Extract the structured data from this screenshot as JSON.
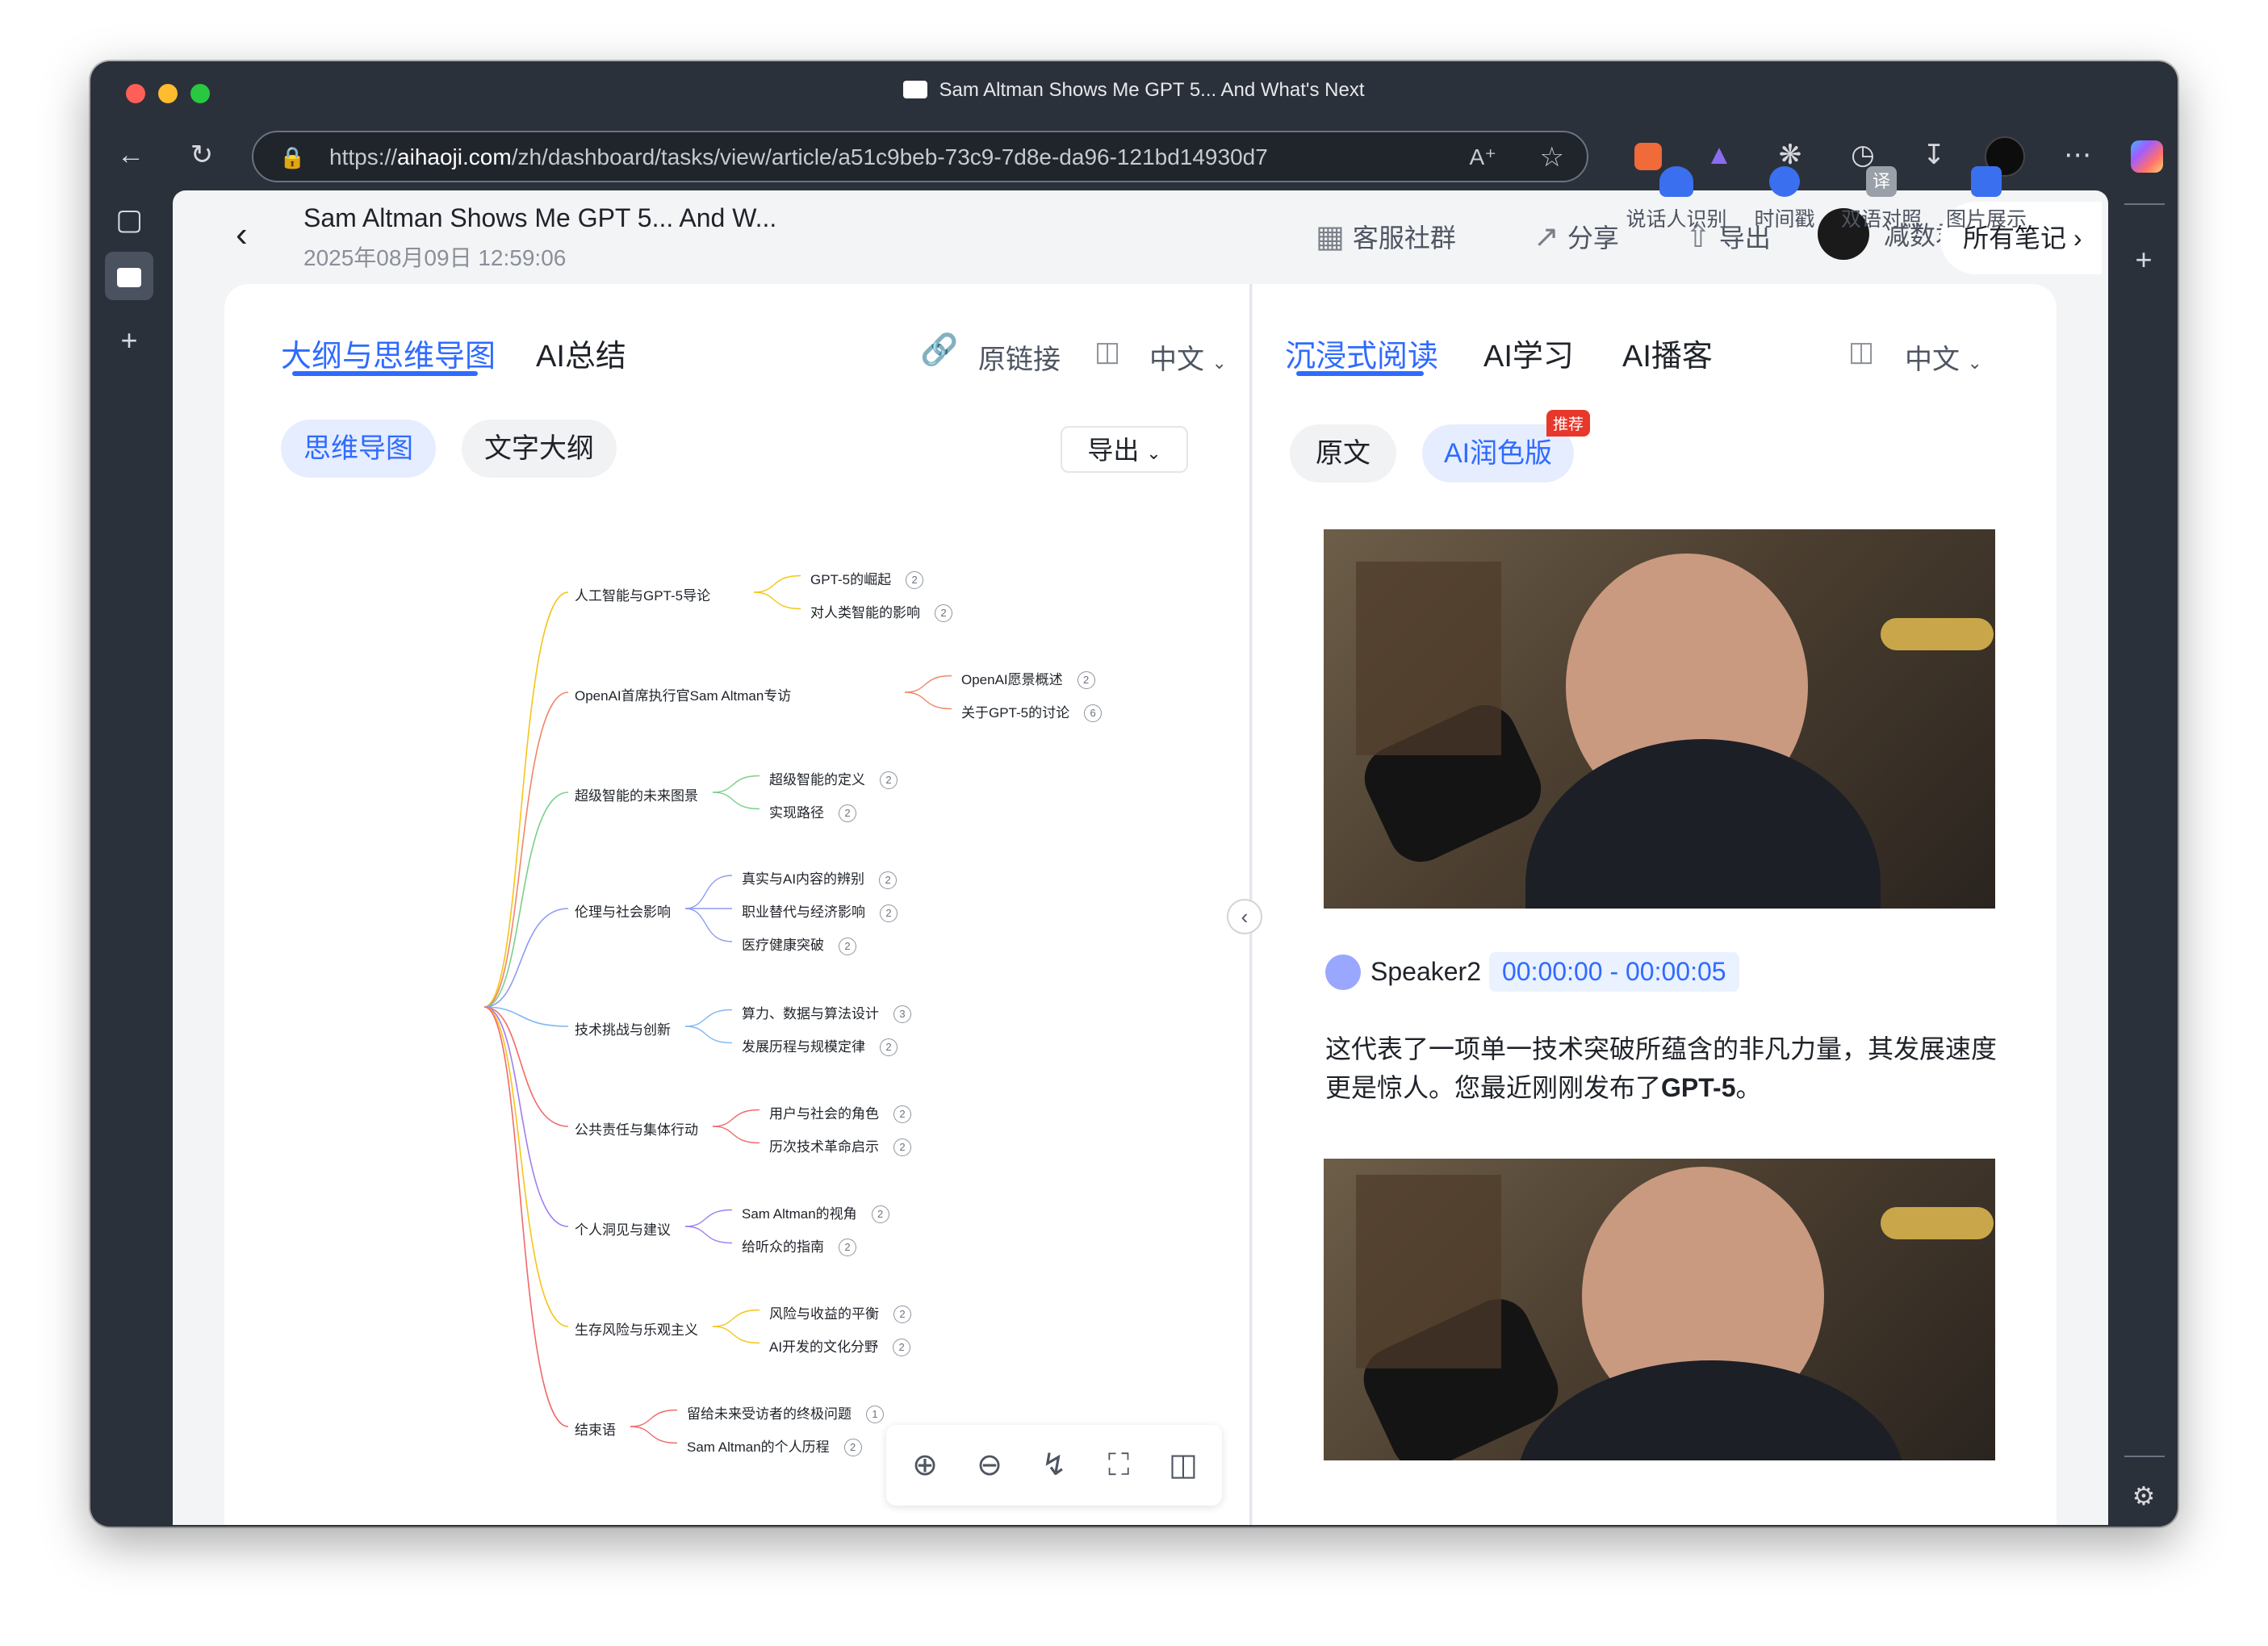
{
  "browser": {
    "tab_title": "Sam Altman Shows Me GPT 5... And What's Next",
    "url_prefix": "https://",
    "url_host": "aihaoji.com",
    "url_path": "/zh/dashboard/tasks/view/article/a51c9beb-73c9-7d8e-da96-121bd14930d7",
    "favicon_text": "AI好记"
  },
  "header": {
    "title": "Sam Altman Shows Me GPT 5... And W...",
    "date": "2025年08月09日 12:59:06",
    "community": "客服社群",
    "share": "分享",
    "export": "导出",
    "user": "减数君",
    "all_notes": "所有笔记"
  },
  "left": {
    "tabs": [
      "大纲与思维导图",
      "AI总结"
    ],
    "original_link": "原链接",
    "language": "中文",
    "modes": [
      "思维导图",
      "文字大纲"
    ],
    "export_dropdown": "导出"
  },
  "mindmap": [
    {
      "label": "人工智能与GPT-5导论",
      "children": [
        {
          "label": "GPT-5的崛起",
          "n": "2"
        },
        {
          "label": "对人类智能的影响",
          "n": "2"
        }
      ]
    },
    {
      "label": "OpenAI首席执行官Sam Altman专访",
      "children": [
        {
          "label": "OpenAI愿景概述",
          "n": "2"
        },
        {
          "label": "关于GPT-5的讨论",
          "n": "6"
        }
      ]
    },
    {
      "label": "超级智能的未来图景",
      "children": [
        {
          "label": "超级智能的定义",
          "n": "2"
        },
        {
          "label": "实现路径",
          "n": "2"
        }
      ]
    },
    {
      "label": "伦理与社会影响",
      "children": [
        {
          "label": "真实与AI内容的辨别",
          "n": "2"
        },
        {
          "label": "职业替代与经济影响",
          "n": "2"
        },
        {
          "label": "医疗健康突破",
          "n": "2"
        }
      ]
    },
    {
      "label": "技术挑战与创新",
      "children": [
        {
          "label": "算力、数据与算法设计",
          "n": "3"
        },
        {
          "label": "发展历程与规模定律",
          "n": "2"
        }
      ]
    },
    {
      "label": "公共责任与集体行动",
      "children": [
        {
          "label": "用户与社会的角色",
          "n": "2"
        },
        {
          "label": "历次技术革命启示",
          "n": "2"
        }
      ]
    },
    {
      "label": "个人洞见与建议",
      "children": [
        {
          "label": "Sam Altman的视角",
          "n": "2"
        },
        {
          "label": "给听众的指南",
          "n": "2"
        }
      ]
    },
    {
      "label": "生存风险与乐观主义",
      "children": [
        {
          "label": "风险与收益的平衡",
          "n": "2"
        },
        {
          "label": "AI开发的文化分野",
          "n": "2"
        }
      ]
    },
    {
      "label": "结束语",
      "children": [
        {
          "label": "留给未来受访者的终极问题",
          "n": "1"
        },
        {
          "label": "Sam Altman的个人历程",
          "n": "2"
        }
      ]
    }
  ],
  "right": {
    "tabs": [
      "沉浸式阅读",
      "AI学习",
      "AI播客"
    ],
    "language": "中文",
    "modes": [
      "原文",
      "AI润色版"
    ],
    "recommend_badge": "推荐",
    "tools": [
      "说话人识别",
      "时间戳",
      "双语对照",
      "图片展示"
    ],
    "speaker": "Speaker2",
    "timestamp": "00:00:00 - 00:00:05",
    "transcript_plain": "这代表了一项单一技术突破所蕴含的非凡力量，其发展速度更是惊人。您最近刚刚发布了",
    "transcript_bold": "GPT-5",
    "transcript_end": "。"
  },
  "colors": {
    "accent": "#2f6bff",
    "branch_colors": [
      "#f5c518",
      "#f0876a",
      "#7ad08a",
      "#8e9bf2",
      "#7fb8f0",
      "#f06a6a",
      "#a07ef0",
      "#f5c518",
      "#f06a6a"
    ]
  }
}
